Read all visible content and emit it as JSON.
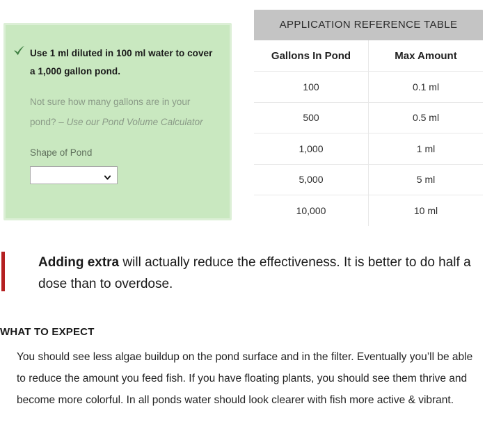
{
  "dosage_panel": {
    "check_icon": "check-icon",
    "headline": "Use 1 ml diluted in 100 ml water to cover a 1,000 gallon pond.",
    "note_text": "Not sure how many gallons are in your pond? – ",
    "note_link": "Use our Pond Volume Calculator",
    "shape_label": "Shape of Pond",
    "shape_select_value": "",
    "shape_select_icon": "chevron-down-icon",
    "panel_bg": "#c9e8c0",
    "panel_border": "#dcefd6",
    "check_color": "#3f7f42"
  },
  "reference_table": {
    "title": "APPLICATION REFERENCE TABLE",
    "title_bg": "#c4c4c4",
    "columns": [
      "Gallons In Pond",
      "Max Amount"
    ],
    "rows": [
      [
        "100",
        "0.1 ml"
      ],
      [
        "500",
        "0.5 ml"
      ],
      [
        "1,000",
        "1 ml"
      ],
      [
        "5,000",
        "5 ml"
      ],
      [
        "10,000",
        "10 ml"
      ]
    ]
  },
  "callout": {
    "bar_color": "#b41f20",
    "lead": "Adding extra",
    "rest": " will actually reduce the effectiveness. It is better to do half a dose than to overdose."
  },
  "expect": {
    "heading": "WHAT TO EXPECT",
    "body": "You should see less algae buildup on the pond surface and in the filter. Eventually you’ll be able to reduce the amount you feed fish. If you have floating plants, you should see them thrive and become more colorful. In all ponds water should look clearer with fish more active & vibrant."
  }
}
